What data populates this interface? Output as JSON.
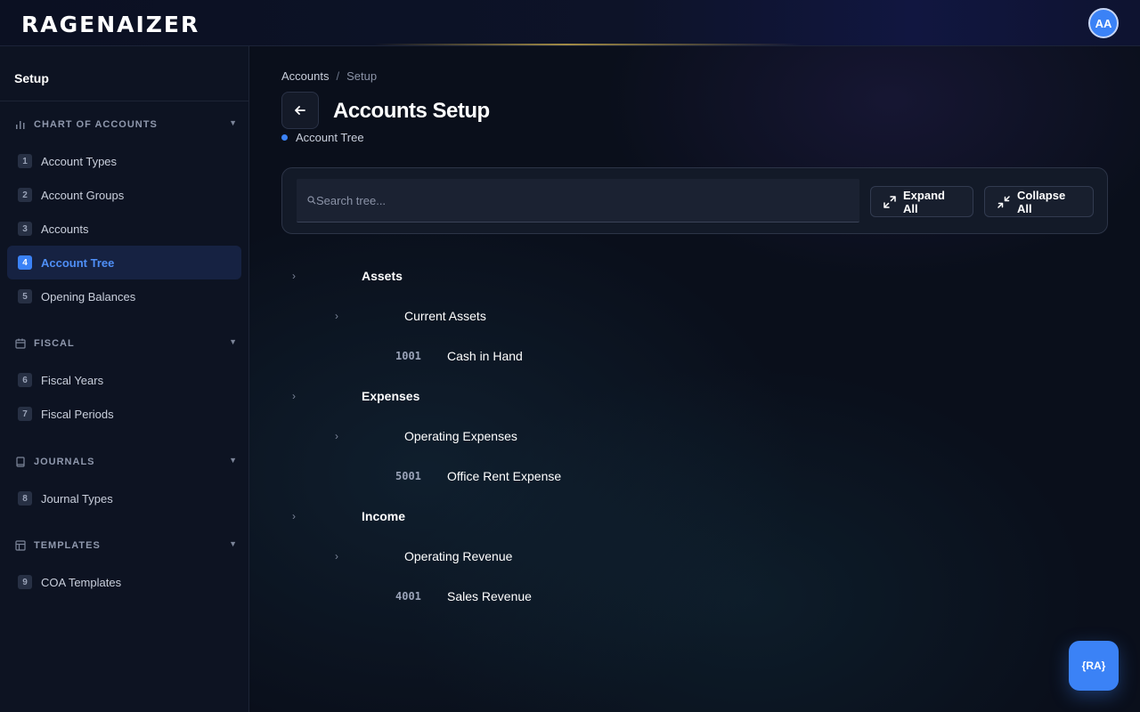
{
  "app": {
    "logo": "RAGENAIZER",
    "avatar_initials": "AA",
    "accent_color": "#3b82f6"
  },
  "sidebar": {
    "title": "Setup",
    "sections": [
      {
        "label": "CHART OF ACCOUNTS",
        "icon": "bar-chart-icon",
        "items": [
          {
            "num": "1",
            "label": "Account Types"
          },
          {
            "num": "2",
            "label": "Account Groups"
          },
          {
            "num": "3",
            "label": "Accounts"
          },
          {
            "num": "4",
            "label": "Account Tree",
            "active": true
          },
          {
            "num": "5",
            "label": "Opening Balances"
          }
        ]
      },
      {
        "label": "FISCAL",
        "icon": "calendar-icon",
        "items": [
          {
            "num": "6",
            "label": "Fiscal Years"
          },
          {
            "num": "7",
            "label": "Fiscal Periods"
          }
        ]
      },
      {
        "label": "JOURNALS",
        "icon": "book-icon",
        "items": [
          {
            "num": "8",
            "label": "Journal Types"
          }
        ]
      },
      {
        "label": "TEMPLATES",
        "icon": "template-icon",
        "items": [
          {
            "num": "9",
            "label": "COA Templates"
          }
        ]
      }
    ]
  },
  "breadcrumb": {
    "items": [
      "Accounts",
      "Setup"
    ],
    "separator": "/"
  },
  "page": {
    "title": "Accounts Setup",
    "subtitle": "Account Tree"
  },
  "toolbar": {
    "search_placeholder": "Search tree...",
    "expand_label": "Expand All",
    "collapse_label": "Collapse All"
  },
  "tree": [
    {
      "label": "Assets",
      "children": [
        {
          "label": "Current Assets",
          "children": [
            {
              "code": "1001",
              "label": "Cash in Hand"
            }
          ]
        }
      ]
    },
    {
      "label": "Expenses",
      "children": [
        {
          "label": "Operating Expenses",
          "children": [
            {
              "code": "5001",
              "label": "Office Rent Expense"
            }
          ]
        }
      ]
    },
    {
      "label": "Income",
      "children": [
        {
          "label": "Operating Revenue",
          "children": [
            {
              "code": "4001",
              "label": "Sales Revenue"
            }
          ]
        }
      ]
    }
  ],
  "fab": {
    "label": "{RA}",
    "icon": "assistant-icon"
  }
}
